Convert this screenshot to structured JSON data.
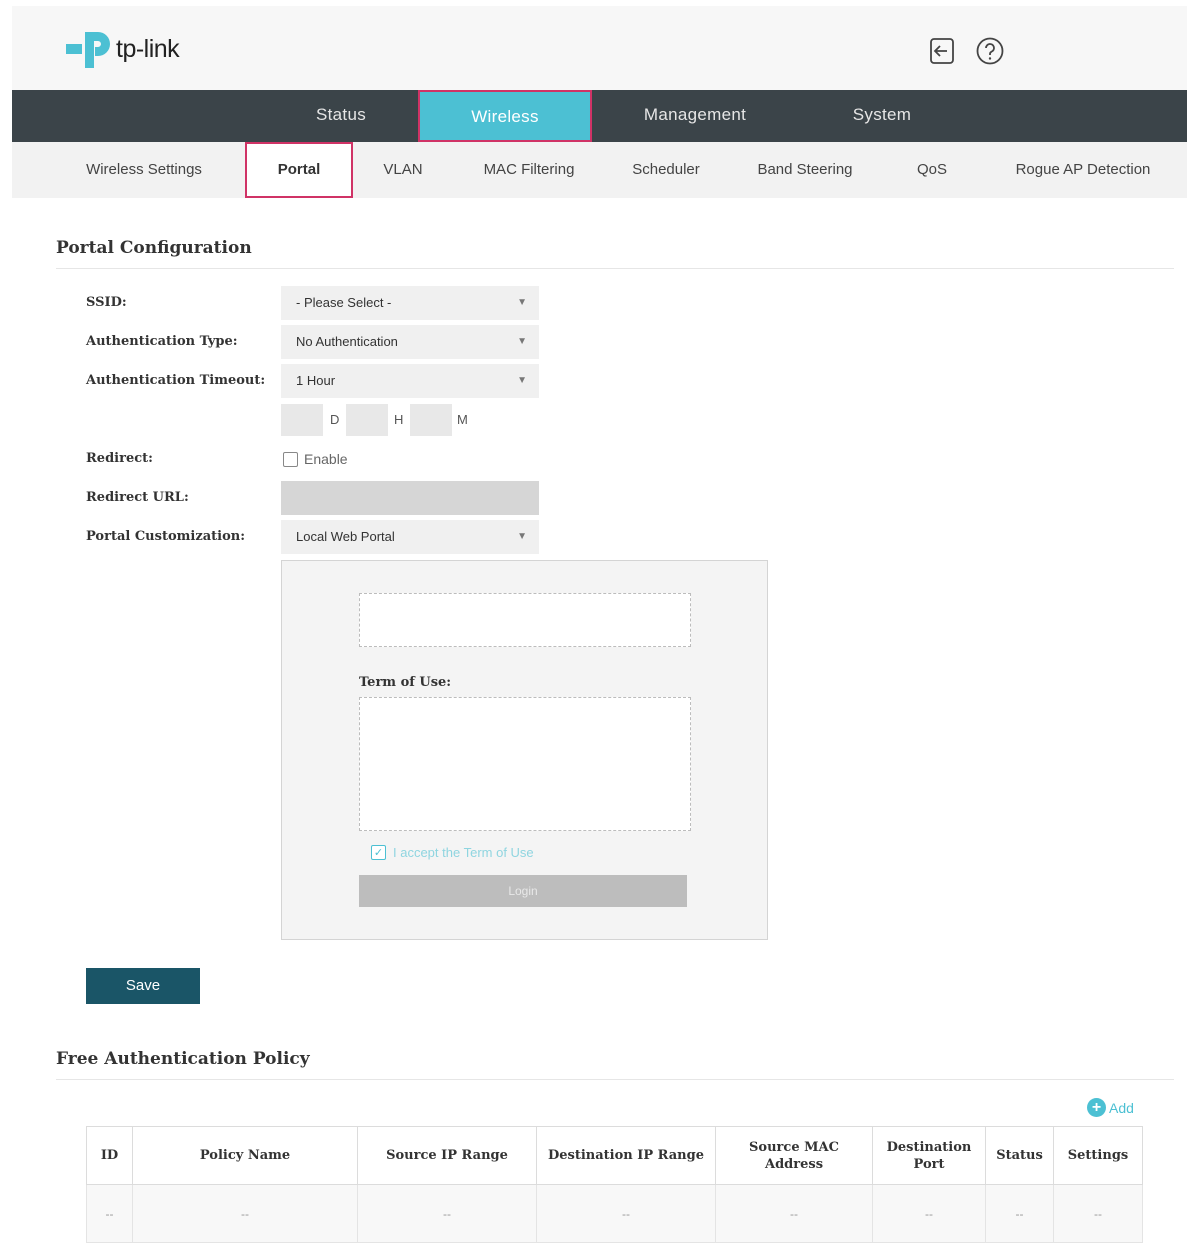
{
  "brand": {
    "name": "tp-link",
    "accent": "#4cc0d3",
    "highlight": "#d03366",
    "nav_bg": "#3b4449",
    "primary_button": "#1a5567"
  },
  "header": {
    "logout_icon": "logout-icon",
    "help_icon": "help-icon"
  },
  "main_nav": {
    "tabs": [
      {
        "label": "Status"
      },
      {
        "label": "Wireless"
      },
      {
        "label": "Management"
      },
      {
        "label": "System"
      }
    ],
    "active": "Wireless"
  },
  "sub_nav": {
    "tabs": [
      {
        "label": "Wireless Settings"
      },
      {
        "label": "Portal"
      },
      {
        "label": "VLAN"
      },
      {
        "label": "MAC Filtering"
      },
      {
        "label": "Scheduler"
      },
      {
        "label": "Band Steering"
      },
      {
        "label": "QoS"
      },
      {
        "label": "Rogue AP Detection"
      }
    ],
    "active": "Portal"
  },
  "portal_config": {
    "title": "Portal Configuration",
    "ssid": {
      "label": "SSID:",
      "value": "- Please Select -"
    },
    "auth_type": {
      "label": "Authentication Type:",
      "value": "No Authentication"
    },
    "auth_timeout": {
      "label": "Authentication Timeout:",
      "value": "1 Hour",
      "units": {
        "d": "D",
        "h": "H",
        "m": "M"
      }
    },
    "redirect": {
      "label": "Redirect:",
      "checkbox_label": "Enable",
      "checked": false
    },
    "redirect_url": {
      "label": "Redirect URL:",
      "value": ""
    },
    "portal_customization": {
      "label": "Portal Customization:",
      "value": "Local Web Portal"
    },
    "preview": {
      "term_label": "Term of Use:",
      "accept_text": "I accept the Term of Use",
      "accept_checked": true,
      "login_label": "Login"
    },
    "save_label": "Save"
  },
  "free_auth": {
    "title": "Free Authentication Policy",
    "add_label": "Add",
    "columns": [
      "ID",
      "Policy Name",
      "Source IP Range",
      "Destination IP Range",
      "Source MAC Address",
      "Destination Port",
      "Status",
      "Settings"
    ],
    "rows": [
      [
        "--",
        "--",
        "--",
        "--",
        "--",
        "--",
        "--",
        "--"
      ]
    ]
  }
}
